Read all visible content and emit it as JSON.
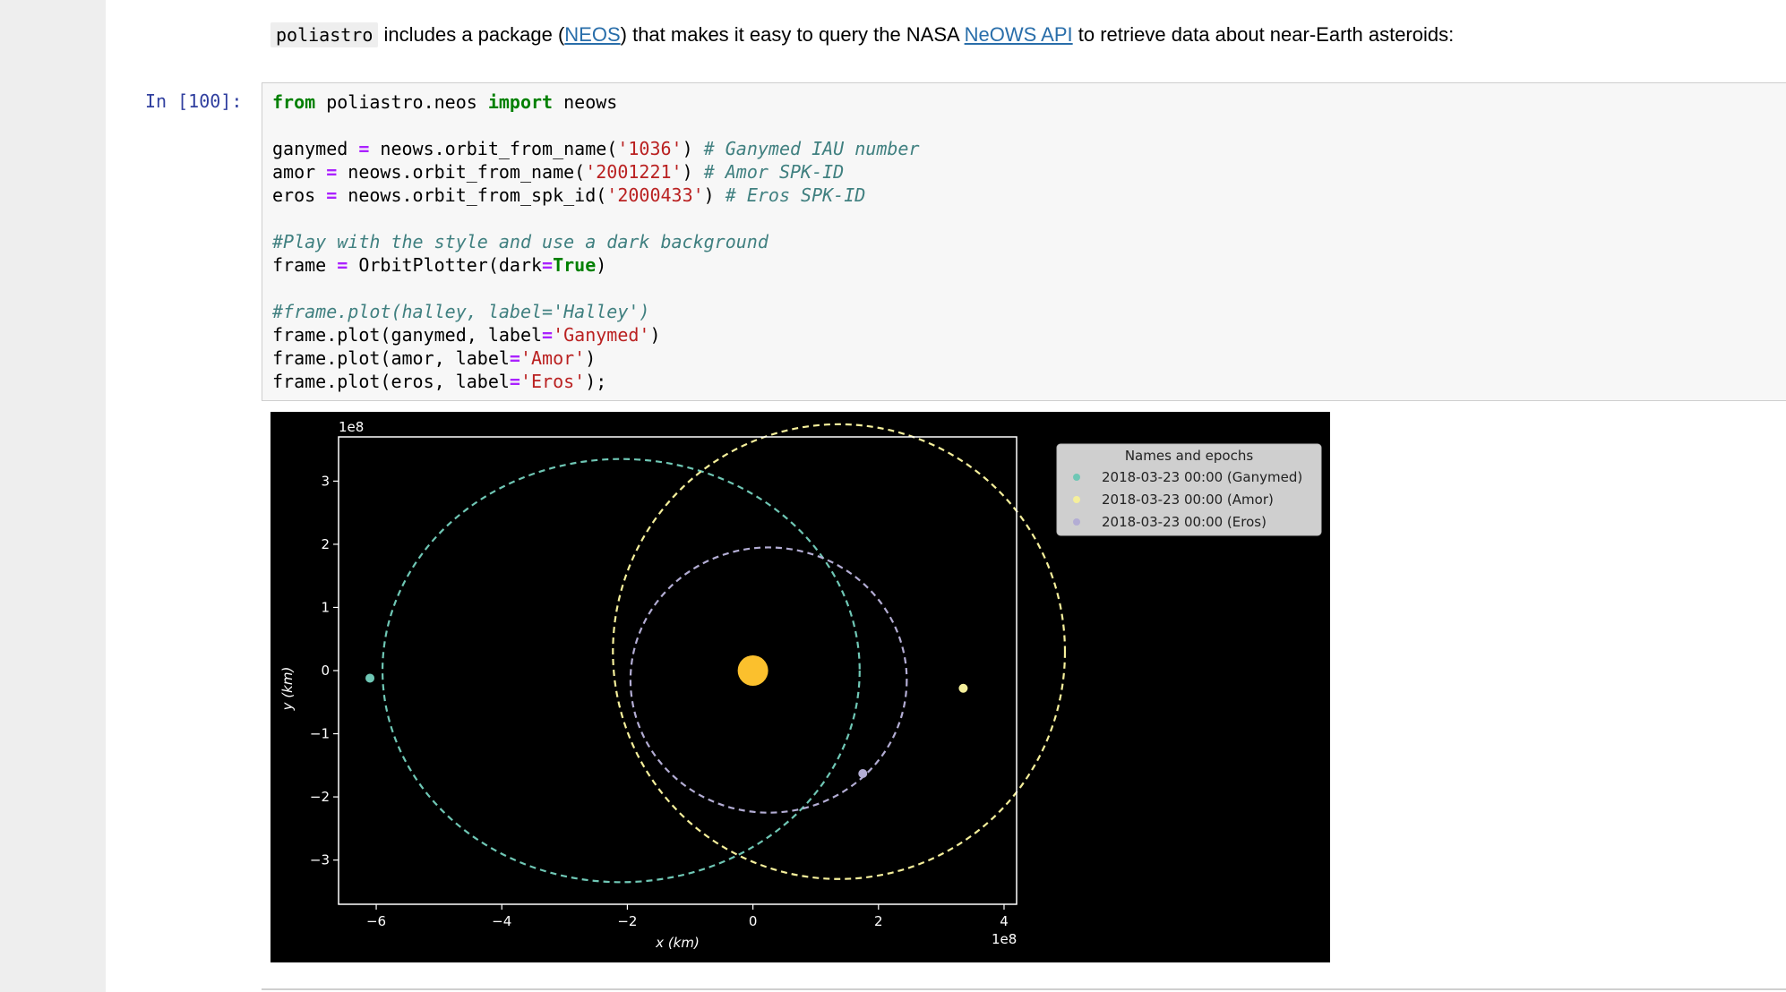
{
  "markdown": {
    "code_word": "poliastro",
    "text_1": " includes a package (",
    "link_neos": "NEOS",
    "text_2": ") that makes it easy to query the NASA ",
    "link_neows": "NeOWS API",
    "text_3": " to retrieve data about near-Earth asteroids:"
  },
  "cell": {
    "prompt": "In [100]:",
    "lines": [
      [
        {
          "t": "kw",
          "v": "from"
        },
        {
          "t": "",
          "v": " poliastro.neos "
        },
        {
          "t": "kw",
          "v": "import"
        },
        {
          "t": "",
          "v": " neows"
        }
      ],
      [],
      [
        {
          "t": "",
          "v": "ganymed "
        },
        {
          "t": "op",
          "v": "="
        },
        {
          "t": "",
          "v": " neows.orbit_from_name("
        },
        {
          "t": "str",
          "v": "'1036'"
        },
        {
          "t": "",
          "v": ") "
        },
        {
          "t": "cm",
          "v": "# Ganymed IAU number"
        }
      ],
      [
        {
          "t": "",
          "v": "amor "
        },
        {
          "t": "op",
          "v": "="
        },
        {
          "t": "",
          "v": " neows.orbit_from_name("
        },
        {
          "t": "str",
          "v": "'2001221'"
        },
        {
          "t": "",
          "v": ") "
        },
        {
          "t": "cm",
          "v": "# Amor SPK-ID"
        }
      ],
      [
        {
          "t": "",
          "v": "eros "
        },
        {
          "t": "op",
          "v": "="
        },
        {
          "t": "",
          "v": " neows.orbit_from_spk_id("
        },
        {
          "t": "str",
          "v": "'2000433'"
        },
        {
          "t": "",
          "v": ") "
        },
        {
          "t": "cm",
          "v": "# Eros SPK-ID"
        }
      ],
      [],
      [
        {
          "t": "cm",
          "v": "#Play with the style and use a dark background"
        }
      ],
      [
        {
          "t": "",
          "v": "frame "
        },
        {
          "t": "op",
          "v": "="
        },
        {
          "t": "",
          "v": " OrbitPlotter(dark"
        },
        {
          "t": "op",
          "v": "="
        },
        {
          "t": "kw",
          "v": "True"
        },
        {
          "t": "",
          "v": ")"
        }
      ],
      [],
      [
        {
          "t": "cm",
          "v": "#frame.plot(halley, label='Halley')"
        }
      ],
      [
        {
          "t": "",
          "v": "frame.plot(ganymed, label"
        },
        {
          "t": "op",
          "v": "="
        },
        {
          "t": "str",
          "v": "'Ganymed'"
        },
        {
          "t": "",
          "v": ")"
        }
      ],
      [
        {
          "t": "",
          "v": "frame.plot(amor, label"
        },
        {
          "t": "op",
          "v": "="
        },
        {
          "t": "str",
          "v": "'Amor'"
        },
        {
          "t": "",
          "v": ")"
        }
      ],
      [
        {
          "t": "",
          "v": "frame.plot(eros, label"
        },
        {
          "t": "op",
          "v": "="
        },
        {
          "t": "str",
          "v": "'Eros'"
        },
        {
          "t": "",
          "v": ");"
        }
      ]
    ]
  },
  "chart_data": {
    "type": "line",
    "xlabel": "x (km)",
    "ylabel": "y (km)",
    "x_scale_label": "1e8",
    "y_scale_label": "1e8",
    "xlim": [
      -6.6,
      4.2
    ],
    "ylim": [
      -3.7,
      3.7
    ],
    "xticks": [
      -6,
      -4,
      -2,
      0,
      2,
      4
    ],
    "yticks": [
      3,
      2,
      1,
      0,
      -1,
      -2,
      -3
    ],
    "xtick_labels": [
      "−6",
      "−4",
      "−2",
      "0",
      "2",
      "4"
    ],
    "ytick_labels": [
      "3",
      "2",
      "1",
      "0",
      "−1",
      "−2",
      "−3"
    ],
    "background": "#000000",
    "sun": {
      "x": 0,
      "y": 0,
      "color": "#fbc02d"
    },
    "legend": {
      "title": "Names and epochs",
      "placement": "top-right-outside"
    },
    "series": [
      {
        "name": "2018-03-23 00:00 (Ganymed)",
        "color": "#6fc7b5",
        "center": [
          -2.1,
          0.0
        ],
        "a": 3.8,
        "b": 3.35,
        "position": [
          -6.1,
          -0.12
        ]
      },
      {
        "name": "2018-03-23 00:00 (Amor)",
        "color": "#f5ef9b",
        "center": [
          1.37,
          0.3
        ],
        "a": 3.6,
        "b": 3.6,
        "position": [
          3.35,
          -0.28
        ]
      },
      {
        "name": "2018-03-23 00:00 (Eros)",
        "color": "#b3add4",
        "center": [
          0.25,
          -0.15
        ],
        "a": 2.2,
        "b": 2.1,
        "position": [
          1.75,
          -1.63
        ]
      }
    ]
  }
}
